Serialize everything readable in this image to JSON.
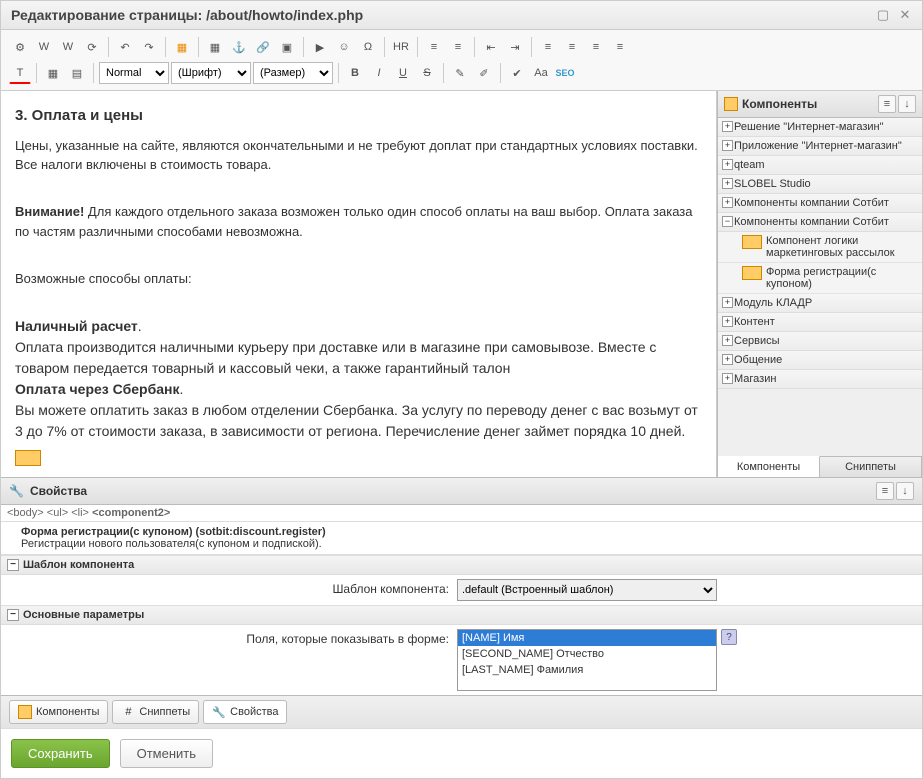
{
  "window": {
    "title": "Редактирование страницы: /about/howto/index.php"
  },
  "toolbar2": {
    "style_select": "Normal",
    "font_select": "(Шрифт)",
    "size_select": "(Размер)"
  },
  "editor": {
    "h3": "3. Оплата и цены",
    "p1": "Цены, указанные на сайте, являются окончательными и не требуют доплат при стандартных условиях поставки. Все налоги включены в стоимость товара.",
    "warn_label": "Внимание!",
    "warn_text": " Для каждого отдельного заказа возможен только один способ оплаты на ваш выбор. Оплата заказа по частям различными способами невозможна.",
    "p3": "Возможные способы оплаты:",
    "m1_title": "Наличный расчет",
    "m1_text": "Оплата производится наличными курьеру при доставке или в магазине при самовывозе. Вместе с товаром передается товарный и кассовый чеки, а также гарантийный талон",
    "m2_title": "Оплата через Сбербанк",
    "m2_text": "Вы можете оплатить заказ в любом отделении Сбербанка. За услугу по переводу денег с вас возьмут от 3 до 7% от стоимости заказа, в зависимости от региона. Перечисление денег займет порядка 10 дней."
  },
  "sidebar": {
    "title": "Компоненты",
    "tabs": {
      "components": "Компоненты",
      "snippets": "Сниппеты"
    },
    "tree": [
      {
        "label": "Решение \"Интернет-магазин\""
      },
      {
        "label": "Приложение \"Интернет-магазин\""
      },
      {
        "label": "qteam"
      },
      {
        "label": "SLOBEL Studio"
      },
      {
        "label": "Компоненты компании Сотбит"
      },
      {
        "label": "Компоненты компании Сотбит",
        "expanded": true,
        "children": [
          {
            "label": "Компонент логики маркетинговых рассылок"
          },
          {
            "label": "Форма регистрации(с купоном)"
          }
        ]
      },
      {
        "label": "Модуль КЛАДР"
      },
      {
        "label": "Контент"
      },
      {
        "label": "Сервисы"
      },
      {
        "label": "Общение"
      },
      {
        "label": "Магазин"
      }
    ]
  },
  "props": {
    "title": "Свойства",
    "breadcrumb": "<body> <ul> <li> <component2>",
    "bc_parts": [
      "<body>",
      "<ul>",
      "<li>",
      "<component2>"
    ],
    "comp_name": "Форма регистрации(с купоном) (sotbit:discount.register)",
    "comp_desc": "Регистрации нового пользователя(с купоном и подпиской).",
    "sec1": "Шаблон компонента",
    "tpl_label": "Шаблон компонента:",
    "tpl_value": ".default (Встроенный шаблон)",
    "sec2": "Основные параметры",
    "fields_label": "Поля, которые показывать в форме:",
    "fields_options": [
      "[NAME] Имя",
      "[SECOND_NAME] Отчество",
      "[LAST_NAME] Фамилия"
    ],
    "fields_selected": 0
  },
  "bottom_tabs": {
    "components": "Компоненты",
    "snippets": "Сниппеты",
    "props": "Свойства"
  },
  "footer": {
    "save": "Сохранить",
    "cancel": "Отменить"
  }
}
